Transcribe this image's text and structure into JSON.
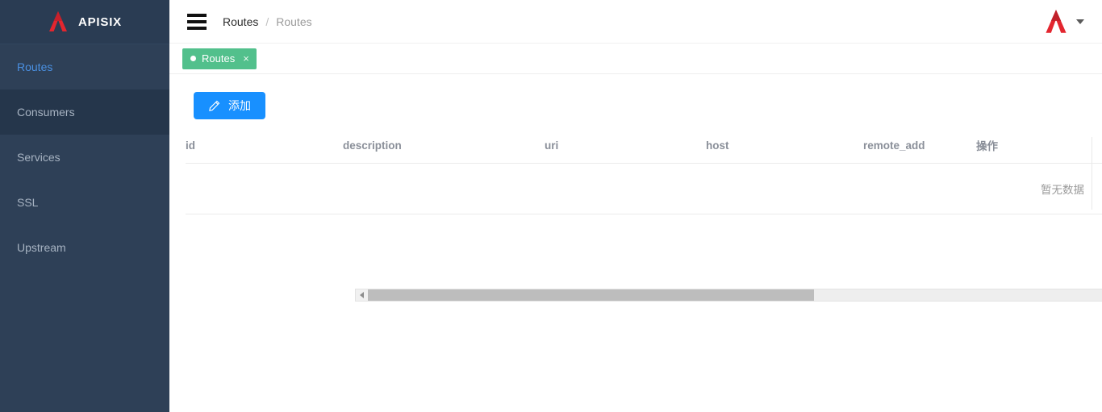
{
  "colors": {
    "sidebar_bg": "#2e4057",
    "sidebar_hover": "#25364b",
    "sidebar_active_text": "#4a90e2",
    "brand_red": "#e3262f",
    "primary_blue": "#1890ff",
    "tag_green": "#52c08c",
    "muted_text": "#8a8f99"
  },
  "sidebar": {
    "brand": "APISIX",
    "logo_icon": "apisix-logo-icon",
    "items": [
      {
        "label": "Routes",
        "active": true,
        "hovered": false
      },
      {
        "label": "Consumers",
        "active": false,
        "hovered": true
      },
      {
        "label": "Services",
        "active": false,
        "hovered": false
      },
      {
        "label": "SSL",
        "active": false,
        "hovered": false
      },
      {
        "label": "Upstream",
        "active": false,
        "hovered": false
      }
    ]
  },
  "topbar": {
    "menu_icon": "hamburger-menu-icon",
    "breadcrumb": {
      "parent": "Routes",
      "separator": "/",
      "current": "Routes"
    },
    "avatar_icon": "apisix-logo-icon",
    "caret_icon": "chevron-down-icon"
  },
  "tagbar": {
    "tags": [
      {
        "label": "Routes",
        "close": "×",
        "dot": "status-dot"
      }
    ]
  },
  "content": {
    "add_button": {
      "label": "添加",
      "icon": "pencil-edit-icon"
    },
    "table": {
      "columns": [
        {
          "key": "id",
          "label": "id"
        },
        {
          "key": "description",
          "label": "description"
        },
        {
          "key": "uri",
          "label": "uri"
        },
        {
          "key": "host",
          "label": "host"
        },
        {
          "key": "remote_add",
          "label": "remote_add"
        },
        {
          "key": "action",
          "label": "操作"
        }
      ],
      "rows": [],
      "empty_text": "暂无数据"
    },
    "scrollbar": {
      "left_arrow": "scroll-left-arrow-icon",
      "right_arrow": "scroll-right-arrow-icon"
    }
  }
}
